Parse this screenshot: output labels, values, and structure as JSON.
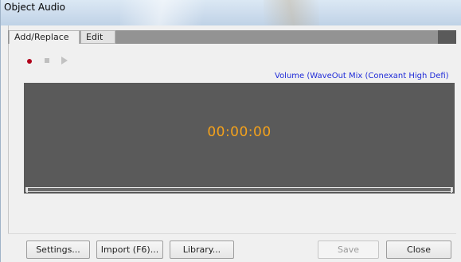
{
  "window": {
    "title": "Object Audio"
  },
  "tabs": [
    {
      "label": "Add/Replace",
      "selected": true
    },
    {
      "label": "Edit",
      "selected": false
    }
  ],
  "transport": {
    "record_icon": "record-icon",
    "stop_icon": "stop-icon",
    "play_icon": "play-icon"
  },
  "volume_link": "Volume (WaveOut Mix (Conexant High Defi)",
  "display": {
    "timecode": "00:00:00"
  },
  "buttons": {
    "settings": "Settings...",
    "import": "Import (F6)...",
    "library": "Library...",
    "save": "Save",
    "close": "Close"
  },
  "colors": {
    "display_bg": "#5a5a5a",
    "timecode": "#f5a21b",
    "record": "#b0001a",
    "link": "#1f2bd8"
  }
}
